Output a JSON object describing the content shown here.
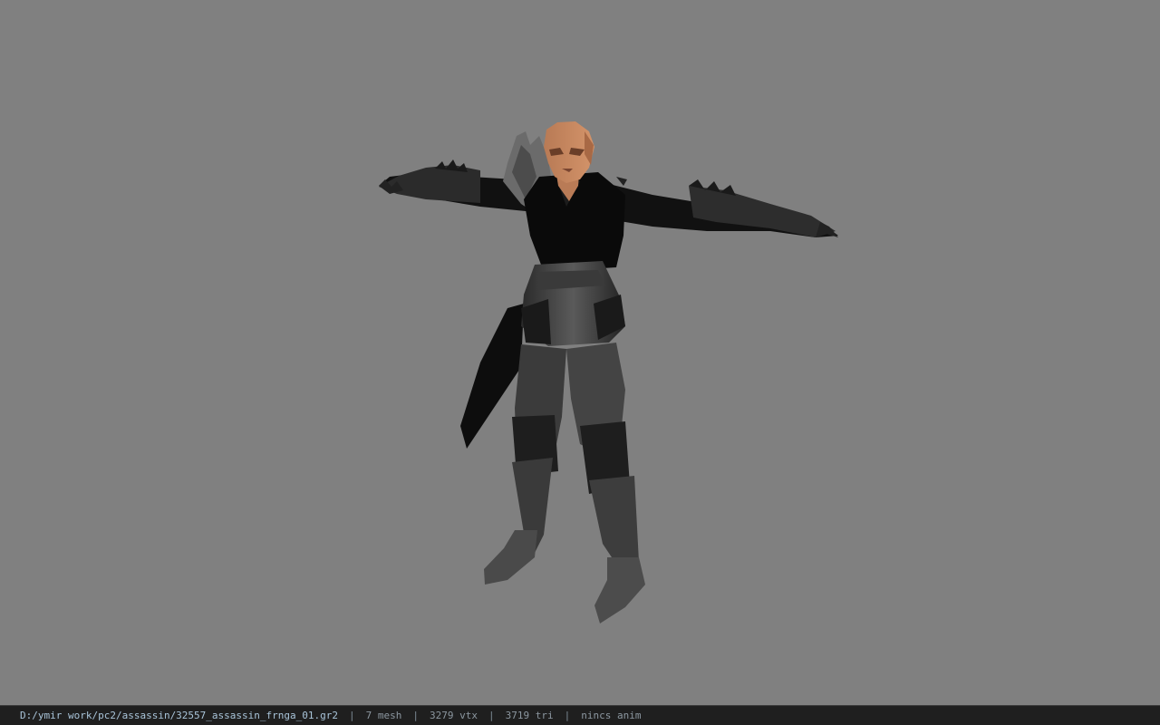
{
  "viewport": {
    "background_color": "#808080",
    "model_name": "assassin character model in T-pose"
  },
  "status_bar": {
    "file_path": "D:/ymir work/pc2/assassin/32557_assassin_frnga_01.gr2",
    "separator": "|",
    "mesh_count": "7 mesh",
    "vertex_count": "3279 vtx",
    "triangle_count": "3719 tri",
    "anim": "nincs anim"
  }
}
